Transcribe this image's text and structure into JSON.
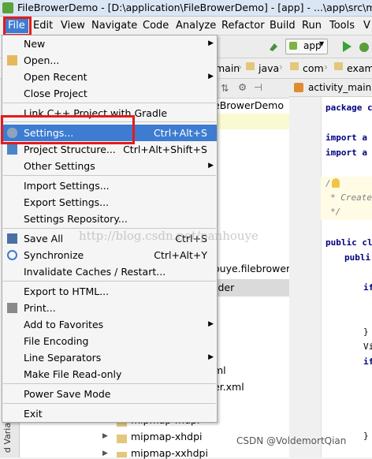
{
  "window": {
    "title": "FileBrowerDemo - [D:\\application\\FileBrowerDemo] - [app] - ...\\app\\src\\main\\"
  },
  "menubar": {
    "items": [
      {
        "label": "File"
      },
      {
        "label": "Edit"
      },
      {
        "label": "View"
      },
      {
        "label": "Navigate"
      },
      {
        "label": "Code"
      },
      {
        "label": "Analyze"
      },
      {
        "label": "Refactor"
      },
      {
        "label": "Build"
      },
      {
        "label": "Run"
      },
      {
        "label": "Tools"
      },
      {
        "label": "V"
      }
    ]
  },
  "toolbar": {
    "run_config": "app"
  },
  "breadcrumb": {
    "items": [
      "main",
      "java",
      "com",
      "exam"
    ]
  },
  "editor_tab": {
    "label": "activity_main.s"
  },
  "project_tree": {
    "items": [
      {
        "label": "eBrowerDemo"
      },
      {
        "label": "ouye.filebrower"
      },
      {
        "label": "lder"
      },
      {
        "label": "ml"
      },
      {
        "label": "er.xml"
      },
      {
        "label": "mipmap-mdpi"
      },
      {
        "label": "mipmap-xhdpi"
      },
      {
        "label": "mipmap-xxhdpi"
      }
    ],
    "side_strip_label": "d Variants"
  },
  "editor_code": {
    "lines": [
      "package c",
      "import a",
      "import a",
      "/",
      "* Created",
      "*/",
      "public cl",
      "publi",
      "if",
      "}",
      "Vi",
      "if",
      "}"
    ]
  },
  "file_menu": {
    "items": [
      {
        "label": "New",
        "shortcut": "",
        "submenu": true,
        "icon": ""
      },
      {
        "label": "Open...",
        "shortcut": "",
        "submenu": false,
        "icon": "folder-icon"
      },
      {
        "label": "Open Recent",
        "shortcut": "",
        "submenu": true,
        "icon": ""
      },
      {
        "label": "Close Project",
        "shortcut": "",
        "submenu": false,
        "icon": ""
      },
      {
        "label": "Link C++ Project with Gradle",
        "shortcut": "",
        "submenu": false,
        "icon": ""
      },
      {
        "label": "Settings...",
        "shortcut": "Ctrl+Alt+S",
        "submenu": false,
        "icon": "settings-icon",
        "selected": true
      },
      {
        "label": "Project Structure...",
        "shortcut": "Ctrl+Alt+Shift+S",
        "submenu": false,
        "icon": "project-structure-icon"
      },
      {
        "label": "Other Settings",
        "shortcut": "",
        "submenu": true,
        "icon": ""
      },
      {
        "label": "Import Settings...",
        "shortcut": "",
        "submenu": false,
        "icon": ""
      },
      {
        "label": "Export Settings...",
        "shortcut": "",
        "submenu": false,
        "icon": ""
      },
      {
        "label": "Settings Repository...",
        "shortcut": "",
        "submenu": false,
        "icon": ""
      },
      {
        "label": "Save All",
        "shortcut": "Ctrl+S",
        "submenu": false,
        "icon": "save-icon"
      },
      {
        "label": "Synchronize",
        "shortcut": "Ctrl+Alt+Y",
        "submenu": false,
        "icon": "sync-icon"
      },
      {
        "label": "Invalidate Caches / Restart...",
        "shortcut": "",
        "submenu": false,
        "icon": ""
      },
      {
        "label": "Export to HTML...",
        "shortcut": "",
        "submenu": false,
        "icon": ""
      },
      {
        "label": "Print...",
        "shortcut": "",
        "submenu": false,
        "icon": "print-icon"
      },
      {
        "label": "Add to Favorites",
        "shortcut": "",
        "submenu": true,
        "icon": ""
      },
      {
        "label": "File Encoding",
        "shortcut": "",
        "submenu": false,
        "icon": ""
      },
      {
        "label": "Line Separators",
        "shortcut": "",
        "submenu": true,
        "icon": ""
      },
      {
        "label": "Make File Read-only",
        "shortcut": "",
        "submenu": false,
        "icon": ""
      },
      {
        "label": "Power Save Mode",
        "shortcut": "",
        "submenu": false,
        "icon": ""
      },
      {
        "label": "Exit",
        "shortcut": "",
        "submenu": false,
        "icon": ""
      }
    ]
  },
  "watermarks": {
    "blog": "http://blog.csdn.net/panhouye",
    "csdn": "CSDN @VoldemortQian"
  },
  "colors": {
    "highlight": "#3d7cd1",
    "annotation_box": "#e31b1b"
  }
}
